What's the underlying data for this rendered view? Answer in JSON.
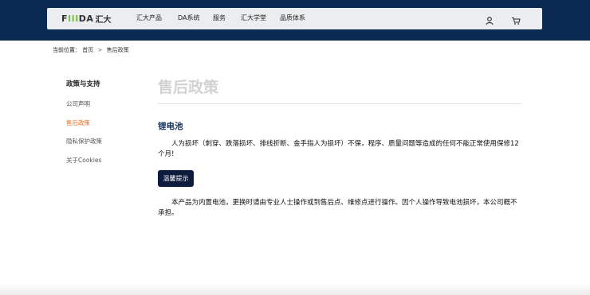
{
  "brand": {
    "logo_latin_a": "F",
    "logo_latin_accent": "III",
    "logo_latin_b": "DA",
    "logo_cn": "汇大"
  },
  "nav": {
    "items": [
      "汇大产品",
      "DA系统",
      "服务",
      "汇大学堂",
      "品质体系"
    ],
    "icons": [
      "user-icon",
      "cart-icon"
    ]
  },
  "breadcrumb": {
    "label": "当前位置：",
    "home": "首页",
    "separator": ">",
    "current": "售后政策"
  },
  "sidebar": {
    "title": "政策与支持",
    "items": [
      {
        "label": "公司声明",
        "active": false
      },
      {
        "label": "售后政策",
        "active": true
      },
      {
        "label": "隐私保护政策",
        "active": false
      },
      {
        "label": "关于Cookies",
        "active": false
      }
    ],
    "active_color": "#e8702a"
  },
  "main": {
    "title": "售后政策",
    "section_title": "锂电池",
    "paragraph1": "人为损坏（刺穿、跌落损坏、排线折断、金手指人为损坏）不保，程序、质量问题等造成的任何不能正常使用保修12个月!",
    "tip_button": "温馨提示",
    "paragraph2": "本产品为内置电池，更换时请由专业人士操作或到售后点、维修点进行操作。因个人操作导致电池损坏，本公司概不承担。"
  },
  "colors": {
    "header_bg": "#0a2a52",
    "section_title": "#14325e",
    "button_bg": "#0d1b3d"
  }
}
